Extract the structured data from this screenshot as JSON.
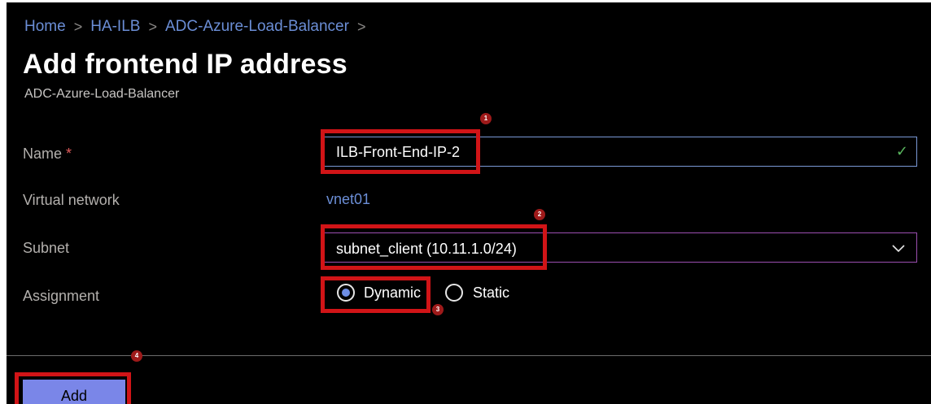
{
  "breadcrumb": {
    "items": [
      "Home",
      "HA-ILB",
      "ADC-Azure-Load-Balancer"
    ],
    "separator": ">"
  },
  "page": {
    "title": "Add frontend IP address",
    "subtitle": "ADC-Azure-Load-Balancer"
  },
  "form": {
    "name": {
      "label": "Name",
      "required_marker": "*",
      "value": "ILB-Front-End-IP-2",
      "valid_icon": "checkmark-icon"
    },
    "virtual_network": {
      "label": "Virtual network",
      "value": "vnet01"
    },
    "subnet": {
      "label": "Subnet",
      "value": "subnet_client (10.11.1.0/24)"
    },
    "assignment": {
      "label": "Assignment",
      "options": [
        "Dynamic",
        "Static"
      ],
      "selected": "Dynamic"
    }
  },
  "footer": {
    "add_label": "Add"
  },
  "annotations": {
    "badges": [
      "1",
      "2",
      "3",
      "4"
    ],
    "highlight_color": "#d11417"
  },
  "colors": {
    "background": "#000000",
    "link": "#6b8ed6",
    "accent": "#7a86e8",
    "valid": "#59b65e",
    "required": "#e15b5b"
  }
}
